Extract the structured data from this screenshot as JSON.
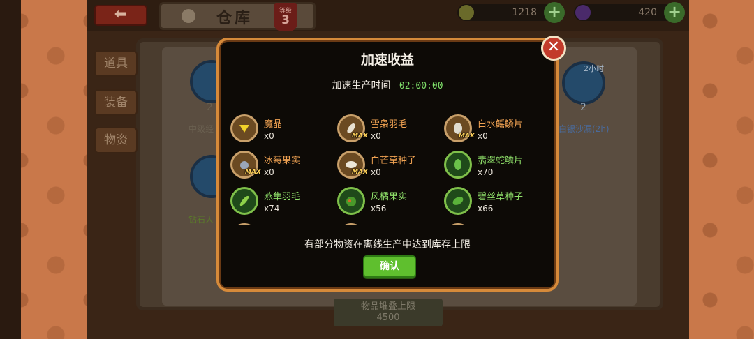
{
  "colors": {
    "dialog_border": "#d68a3a",
    "highlight_green": "#7fe06a",
    "item_orange": "#f0a252",
    "confirm_button": "#5fbf2e",
    "close_button": "#c23a2a"
  },
  "header": {
    "back_icon": "arrow-left-icon",
    "title": "仓库",
    "level_label": "等级",
    "level_value": "3",
    "gold": "1218",
    "gems": "420"
  },
  "side_tabs": [
    "道具",
    "装备",
    "物资"
  ],
  "background": {
    "slot_labels": [
      "中级经",
      "白银沙漏(2h)",
      "钻石人"
    ],
    "slot_counts": [
      "2",
      "2"
    ],
    "slot_time": "2小时",
    "stack_limit_label": "物品堆叠上限",
    "stack_limit_value": "4500"
  },
  "dialog": {
    "title": "加速收益",
    "time_label": "加速生产时间",
    "time_value": "02:00:00",
    "items": [
      {
        "name": "魔晶",
        "count": "x0",
        "max": false,
        "color": "orange",
        "icon": "gem-icon"
      },
      {
        "name": "雪枭羽毛",
        "count": "x0",
        "max": true,
        "color": "orange",
        "icon": "feather-icon"
      },
      {
        "name": "白水鳐鳞片",
        "count": "x0",
        "max": true,
        "color": "orange",
        "icon": "scale-icon"
      },
      {
        "name": "冰莓果实",
        "count": "x0",
        "max": true,
        "color": "orange",
        "icon": "berry-icon"
      },
      {
        "name": "白芒草种子",
        "count": "x0",
        "max": true,
        "color": "orange",
        "icon": "seed-icon"
      },
      {
        "name": "翡翠蛇鳞片",
        "count": "x70",
        "max": false,
        "color": "green",
        "icon": "leaf-scale-icon"
      },
      {
        "name": "燕隼羽毛",
        "count": "x74",
        "max": false,
        "color": "green",
        "icon": "feather-icon"
      },
      {
        "name": "风橘果实",
        "count": "x56",
        "max": false,
        "color": "green",
        "icon": "fruit-icon"
      },
      {
        "name": "碧丝草种子",
        "count": "x66",
        "max": false,
        "color": "green",
        "icon": "seed-icon"
      }
    ],
    "max_tag": "MAX",
    "notice": "有部分物资在离线生产中达到库存上限",
    "confirm": "确认",
    "close_icon": "close-icon"
  }
}
